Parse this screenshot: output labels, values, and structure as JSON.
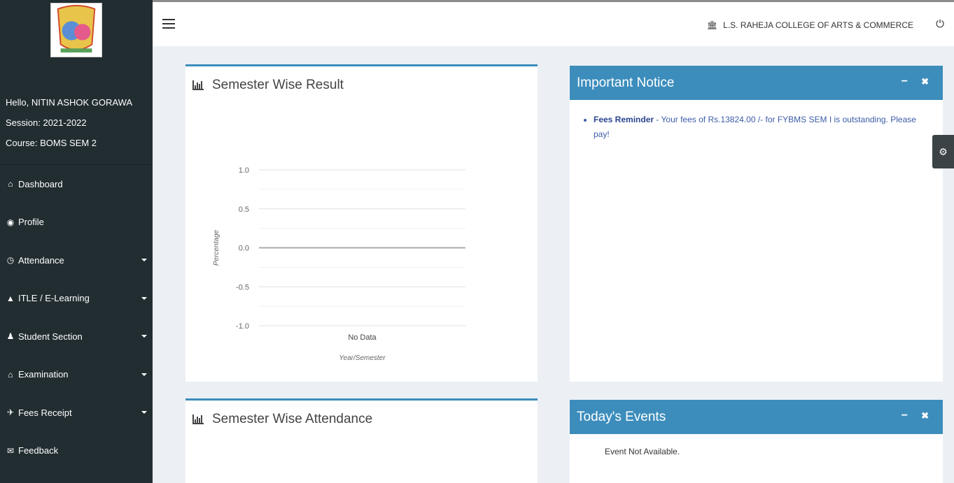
{
  "sidebar": {
    "user": {
      "greeting": "Hello, NITIN ASHOK GORAWA",
      "session": "Session: 2021-2022",
      "course": "Course: BOMS SEM 2"
    },
    "items": [
      {
        "label": "Dashboard",
        "icon": "home-icon",
        "glyph": "⌂"
      },
      {
        "label": "Profile",
        "icon": "user-circle-icon",
        "glyph": "◉"
      },
      {
        "label": "Attendance",
        "icon": "clock-icon",
        "glyph": "◷"
      },
      {
        "label": "ITLE / E-Learning",
        "icon": "graduation-cap-icon",
        "glyph": "▲"
      },
      {
        "label": "Student Section",
        "icon": "user-icon",
        "glyph": "♟"
      },
      {
        "label": "Examination",
        "icon": "institution-icon",
        "glyph": "⌂"
      },
      {
        "label": "Fees Receipt",
        "icon": "rocket-icon",
        "glyph": "✈"
      },
      {
        "label": "Feedback",
        "icon": "comments-icon",
        "glyph": "✉"
      }
    ]
  },
  "topbar": {
    "college_name": "L.S. RAHEJA COLLEGE OF ARTS & COMMERCE",
    "college_icon": "institution-icon",
    "power_icon": "power-icon"
  },
  "semester_result": {
    "title": "Semester Wise Result",
    "chart_data": {
      "type": "line",
      "categories": [
        "No Data"
      ],
      "series": [
        {
          "values": [
            0.0
          ]
        }
      ],
      "xlabel": "Year/Semester",
      "ylabel": "Percentage",
      "yticks": [
        "1.0",
        "0.5",
        "0.0",
        "-0.5",
        "-1.0"
      ],
      "ylim": [
        -1.0,
        1.0
      ],
      "grid": true
    }
  },
  "semester_attendance": {
    "title": "Semester Wise Attendance"
  },
  "notice": {
    "title": "Important Notice",
    "minimize": "−",
    "close": "✖",
    "items": [
      {
        "heading": "Fees Reminder",
        "separator": " - ",
        "text": "Your fees of Rs.13824.00 /- for FYBMS SEM I is outstanding. Please pay!"
      }
    ]
  },
  "events": {
    "title": "Today's Events",
    "minimize": "−",
    "close": "✖",
    "empty_text": "Event Not Available."
  },
  "settings_icon": "gear-icon",
  "colors": {
    "sidebar_bg": "#222d32",
    "accent": "#3c8dbc",
    "page_bg": "#ecf0f5"
  }
}
